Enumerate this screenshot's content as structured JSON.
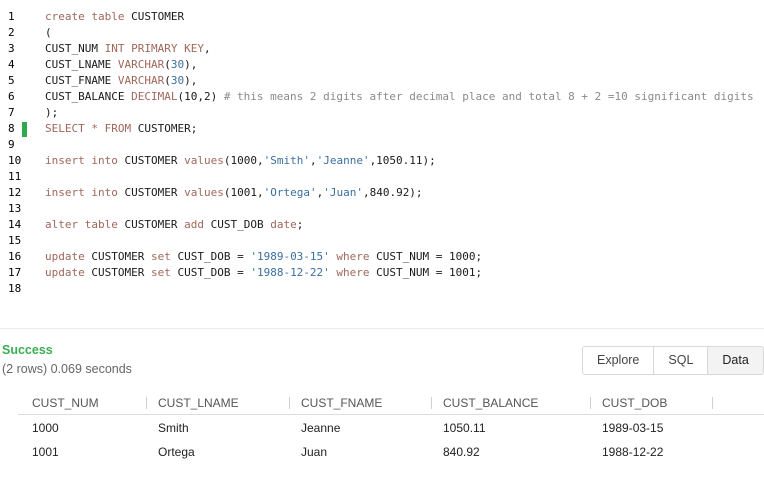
{
  "editor": {
    "lines": [
      {
        "num": "1",
        "tokens": [
          {
            "t": "create table ",
            "c": "k"
          },
          {
            "t": "CUSTOMER",
            "c": "n"
          }
        ]
      },
      {
        "num": "2",
        "tokens": [
          {
            "t": "(",
            "c": "n"
          }
        ]
      },
      {
        "num": "3",
        "tokens": [
          {
            "t": "CUST_NUM ",
            "c": "n"
          },
          {
            "t": "INT PRIMARY KEY",
            "c": "k"
          },
          {
            "t": ",",
            "c": "n"
          }
        ]
      },
      {
        "num": "4",
        "tokens": [
          {
            "t": "CUST_LNAME ",
            "c": "n"
          },
          {
            "t": "VARCHAR",
            "c": "k"
          },
          {
            "t": "(",
            "c": "n"
          },
          {
            "t": "30",
            "c": "s"
          },
          {
            "t": "),",
            "c": "n"
          }
        ]
      },
      {
        "num": "5",
        "tokens": [
          {
            "t": "CUST_FNAME ",
            "c": "n"
          },
          {
            "t": "VARCHAR",
            "c": "k"
          },
          {
            "t": "(",
            "c": "n"
          },
          {
            "t": "30",
            "c": "s"
          },
          {
            "t": "),",
            "c": "n"
          }
        ]
      },
      {
        "num": "6",
        "tokens": [
          {
            "t": "CUST_BALANCE ",
            "c": "n"
          },
          {
            "t": "DECIMAL",
            "c": "k"
          },
          {
            "t": "(10,2) ",
            "c": "n"
          },
          {
            "t": "# this means 2 digits after decimal place and total 8 + 2 =10 significant digits",
            "c": "c"
          }
        ]
      },
      {
        "num": "7",
        "tokens": [
          {
            "t": ");",
            "c": "n"
          }
        ]
      },
      {
        "num": "8",
        "tokens": [
          {
            "t": "SELECT * FROM ",
            "c": "k"
          },
          {
            "t": "CUSTOMER;",
            "c": "n"
          }
        ]
      },
      {
        "num": "9",
        "tokens": []
      },
      {
        "num": "10",
        "tokens": [
          {
            "t": "insert into ",
            "c": "k"
          },
          {
            "t": "CUSTOMER ",
            "c": "n"
          },
          {
            "t": "values",
            "c": "k"
          },
          {
            "t": "(1000,",
            "c": "n"
          },
          {
            "t": "'Smith'",
            "c": "s"
          },
          {
            "t": ",",
            "c": "n"
          },
          {
            "t": "'Jeanne'",
            "c": "s"
          },
          {
            "t": ",1050.11);",
            "c": "n"
          }
        ]
      },
      {
        "num": "11",
        "tokens": []
      },
      {
        "num": "12",
        "tokens": [
          {
            "t": "insert into ",
            "c": "k"
          },
          {
            "t": "CUSTOMER ",
            "c": "n"
          },
          {
            "t": "values",
            "c": "k"
          },
          {
            "t": "(1001,",
            "c": "n"
          },
          {
            "t": "'Ortega'",
            "c": "s"
          },
          {
            "t": ",",
            "c": "n"
          },
          {
            "t": "'Juan'",
            "c": "s"
          },
          {
            "t": ",840.92);",
            "c": "n"
          }
        ]
      },
      {
        "num": "13",
        "tokens": []
      },
      {
        "num": "14",
        "tokens": [
          {
            "t": "alter table ",
            "c": "k"
          },
          {
            "t": "CUSTOMER ",
            "c": "n"
          },
          {
            "t": "add ",
            "c": "k"
          },
          {
            "t": "CUST_DOB ",
            "c": "n"
          },
          {
            "t": "date",
            "c": "k"
          },
          {
            "t": ";",
            "c": "n"
          }
        ]
      },
      {
        "num": "15",
        "tokens": []
      },
      {
        "num": "16",
        "tokens": [
          {
            "t": "update ",
            "c": "k"
          },
          {
            "t": "CUSTOMER ",
            "c": "n"
          },
          {
            "t": "set ",
            "c": "k"
          },
          {
            "t": "CUST_DOB = ",
            "c": "n"
          },
          {
            "t": "'1989-03-15'",
            "c": "s"
          },
          {
            "t": " where ",
            "c": "k"
          },
          {
            "t": "CUST_NUM = 1000;",
            "c": "n"
          }
        ]
      },
      {
        "num": "17",
        "tokens": [
          {
            "t": "update ",
            "c": "k"
          },
          {
            "t": "CUSTOMER ",
            "c": "n"
          },
          {
            "t": "set ",
            "c": "k"
          },
          {
            "t": "CUST_DOB = ",
            "c": "n"
          },
          {
            "t": "'1988-12-22'",
            "c": "s"
          },
          {
            "t": " where ",
            "c": "k"
          },
          {
            "t": "CUST_NUM = 1001;",
            "c": "n"
          }
        ]
      },
      {
        "num": "18",
        "tokens": []
      }
    ],
    "current_line": "8",
    "cursor_color": "#2eaa4c"
  },
  "result": {
    "status": "Success",
    "meta": "(2 rows)  0.069 seconds",
    "tabs": [
      {
        "label": "Explore",
        "active": false
      },
      {
        "label": "SQL",
        "active": false
      },
      {
        "label": "Data",
        "active": true
      }
    ],
    "columns": [
      "CUST_NUM",
      "CUST_LNAME",
      "CUST_FNAME",
      "CUST_BALANCE",
      "CUST_DOB"
    ],
    "rows": [
      [
        "1000",
        "Smith",
        "Jeanne",
        "1050.11",
        "1989-03-15"
      ],
      [
        "1001",
        "Ortega",
        "Juan",
        "840.92",
        "1988-12-22"
      ]
    ]
  }
}
